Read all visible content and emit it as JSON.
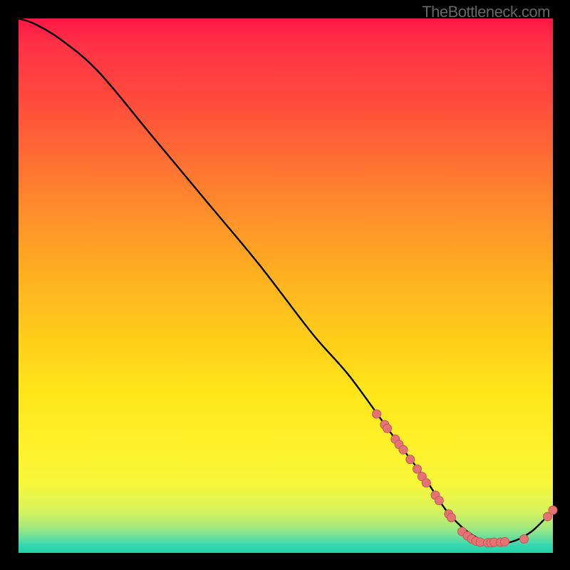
{
  "watermark": "TheBottleneck.com",
  "colors": {
    "line": "#000000",
    "marker_fill": "#e57373",
    "marker_stroke": "#c05858",
    "background_black": "#000000"
  },
  "chart_data": {
    "type": "line",
    "title": "",
    "xlabel": "",
    "ylabel": "",
    "xlim": [
      0,
      100
    ],
    "ylim": [
      0,
      100
    ],
    "note": "Axes are unlabeled; values below are percentages of the plot area (0 at bottom-left to 100 at top-right).",
    "series": [
      {
        "name": "curve",
        "x": [
          0,
          3,
          8,
          15,
          25,
          35,
          45,
          55,
          62,
          70,
          76,
          80,
          84,
          88,
          92,
          96,
          100
        ],
        "y": [
          100,
          99,
          96,
          90,
          78,
          66,
          54,
          41,
          33,
          22,
          14,
          8,
          4,
          2,
          2,
          4,
          8
        ]
      }
    ],
    "markers": [
      {
        "x": 67.0,
        "y": 26.0
      },
      {
        "x": 68.5,
        "y": 24.0
      },
      {
        "x": 69.0,
        "y": 23.3
      },
      {
        "x": 70.5,
        "y": 21.3
      },
      {
        "x": 71.2,
        "y": 20.3
      },
      {
        "x": 72.0,
        "y": 19.3
      },
      {
        "x": 73.3,
        "y": 17.5
      },
      {
        "x": 74.6,
        "y": 15.7
      },
      {
        "x": 75.5,
        "y": 14.3
      },
      {
        "x": 76.3,
        "y": 13.1
      },
      {
        "x": 78.0,
        "y": 10.8
      },
      {
        "x": 78.7,
        "y": 9.8
      },
      {
        "x": 80.5,
        "y": 7.3
      },
      {
        "x": 81.0,
        "y": 6.6
      },
      {
        "x": 83.0,
        "y": 4.0
      },
      {
        "x": 84.0,
        "y": 3.2
      },
      {
        "x": 84.8,
        "y": 2.6
      },
      {
        "x": 85.6,
        "y": 2.2
      },
      {
        "x": 86.4,
        "y": 2.0
      },
      {
        "x": 87.8,
        "y": 1.9
      },
      {
        "x": 88.4,
        "y": 1.9
      },
      {
        "x": 89.0,
        "y": 2.0
      },
      {
        "x": 90.2,
        "y": 2.0
      },
      {
        "x": 91.0,
        "y": 2.1
      },
      {
        "x": 94.6,
        "y": 2.6
      },
      {
        "x": 99.0,
        "y": 6.8
      },
      {
        "x": 100.0,
        "y": 8.0
      }
    ],
    "marker_radius_px": 6
  }
}
